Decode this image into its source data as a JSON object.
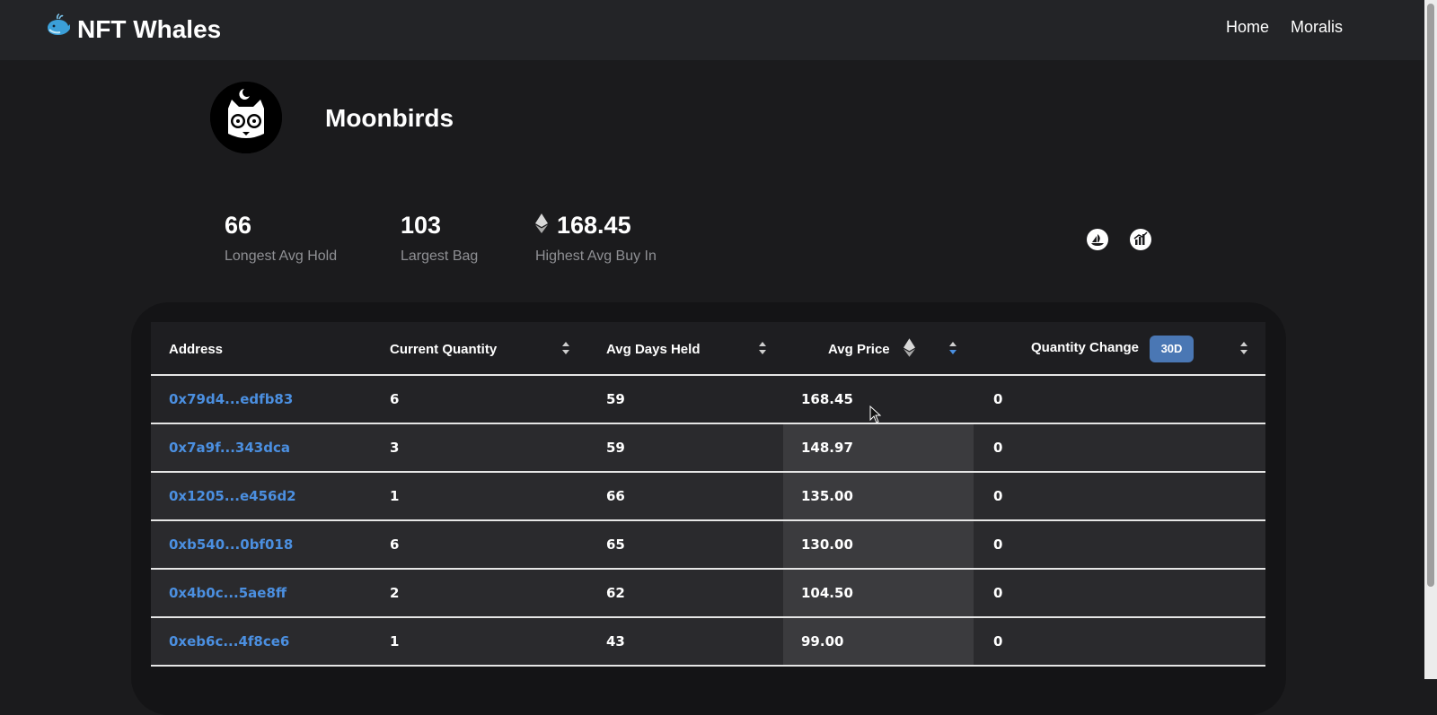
{
  "navbar": {
    "brand_icon": "whale-icon",
    "brand_title": "NFT Whales",
    "links": [
      "Home",
      "Moralis"
    ]
  },
  "collection": {
    "name": "Moonbirds",
    "avatar_icon": "owl-avatar"
  },
  "stats": [
    {
      "value": "66",
      "label": "Longest Avg Hold"
    },
    {
      "value": "103",
      "label": "Largest Bag"
    },
    {
      "value": "168.45",
      "label": "Highest Avg Buy In",
      "icon": "eth-icon"
    }
  ],
  "external_icons": [
    "opensea-icon",
    "analytics-icon"
  ],
  "table": {
    "headers": {
      "address": "Address",
      "current_quantity": "Current Quantity",
      "avg_days_held": "Avg Days Held",
      "avg_price": "Avg Price",
      "quantity_change": "Quantity Change",
      "period_badge": "30D"
    },
    "rows": [
      {
        "address": "0x79d4...edfb83",
        "quantity": "6",
        "days": "59",
        "price": "168.45",
        "change": "0"
      },
      {
        "address": "0x7a9f...343dca",
        "quantity": "3",
        "days": "59",
        "price": "148.97",
        "change": "0"
      },
      {
        "address": "0x1205...e456d2",
        "quantity": "1",
        "days": "66",
        "price": "135.00",
        "change": "0"
      },
      {
        "address": "0xb540...0bf018",
        "quantity": "6",
        "days": "65",
        "price": "130.00",
        "change": "0"
      },
      {
        "address": "0x4b0c...5ae8ff",
        "quantity": "2",
        "days": "62",
        "price": "104.50",
        "change": "0"
      },
      {
        "address": "0xeb6c...4f8ce6",
        "quantity": "1",
        "days": "43",
        "price": "99.00",
        "change": "0"
      }
    ]
  },
  "colors": {
    "accent": "#4a77b4",
    "link": "#4b8fe0",
    "background": "#1b1b1d",
    "navbar": "#232427"
  }
}
